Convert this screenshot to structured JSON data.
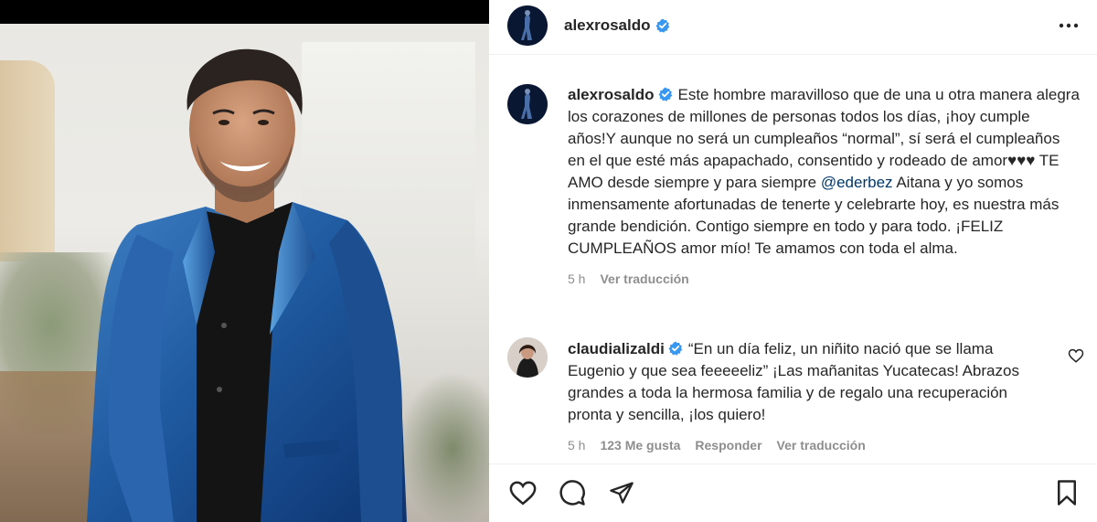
{
  "post": {
    "author": "alexrosaldo",
    "more_icon": "more-options-icon"
  },
  "caption": {
    "author": "alexrosaldo",
    "text_part1": "Este hombre maravilloso que de una u otra manera alegra los corazones de millones de personas todos los días, ¡hoy cumple años!Y aunque no será un cumpleaños “normal”, sí será el cumpleaños en el que esté más apapachado, consentido y rodeado de amor♥♥♥ TE AMO desde siempre y para siempre ",
    "mention": "@ederbez",
    "text_part2": " Aitana y yo somos inmensamente afortunadas de tenerte y celebrarte hoy, es nuestra más grande bendición. Contigo siempre en todo y para todo. ¡FELIZ CUMPLEAÑOS amor mío! Te amamos con toda el alma.",
    "time": "5 h",
    "translate": "Ver traducción"
  },
  "comment": {
    "author": "claudializaldi",
    "text": "“En un día feliz, un niñito nació que se llama Eugenio y que sea feeeeeliz” ¡Las mañanitas Yucatecas! Abrazos grandes a toda la hermosa familia y de regalo una recuperación pronta y sencilla, ¡los quiero!",
    "time": "5 h",
    "likes": "123 Me gusta",
    "reply": "Responder",
    "translate": "Ver traducción"
  },
  "colors": {
    "verified": "#3897f0",
    "mention": "#00376b",
    "meta": "#8e8e8e",
    "text": "#262626"
  }
}
